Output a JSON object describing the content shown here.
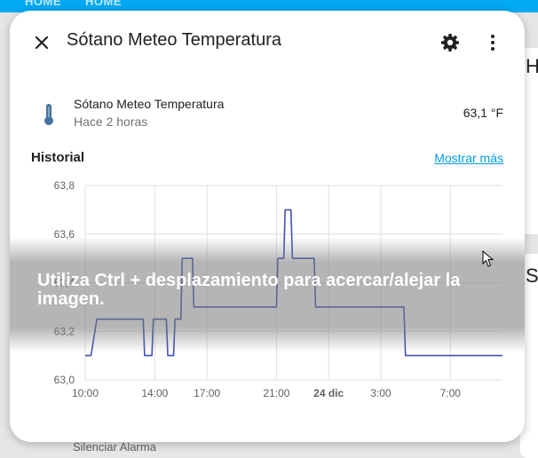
{
  "background": {
    "tabs": [
      "HOME",
      "HOME"
    ],
    "right_letters": [
      "H",
      "S"
    ],
    "bottom_text": "Silenciar Alarma"
  },
  "dialog": {
    "title": "Sótano Meteo Temperatura",
    "icons": {
      "close": "close-icon",
      "settings": "gear-icon",
      "menu": "dots-vertical-icon"
    }
  },
  "entity": {
    "icon": "thermometer-icon",
    "name": "Sótano Meteo Temperatura",
    "last_changed": "Hace 2 horas",
    "state": "63,1 °F"
  },
  "history": {
    "label": "Historial",
    "show_more": "Mostrar más"
  },
  "chart_data": {
    "type": "line",
    "series": [
      {
        "color": "#3f51b5",
        "points": [
          [
            "10:00",
            63.1
          ],
          [
            "10:20",
            63.1
          ],
          [
            "10:40",
            63.25
          ],
          [
            "13:20",
            63.25
          ],
          [
            "13:25",
            63.1
          ],
          [
            "13:50",
            63.1
          ],
          [
            "13:55",
            63.25
          ],
          [
            "14:40",
            63.25
          ],
          [
            "14:45",
            63.1
          ],
          [
            "15:05",
            63.1
          ],
          [
            "15:10",
            63.25
          ],
          [
            "15:30",
            63.25
          ],
          [
            "15:35",
            63.5
          ],
          [
            "16:10",
            63.5
          ],
          [
            "16:15",
            63.3
          ],
          [
            "21:00",
            63.3
          ],
          [
            "21:05",
            63.5
          ],
          [
            "21:25",
            63.5
          ],
          [
            "21:30",
            63.7
          ],
          [
            "21:50",
            63.7
          ],
          [
            "21:55",
            63.5
          ],
          [
            "23:10",
            63.5
          ],
          [
            "23:15",
            63.3
          ],
          [
            "04:20",
            63.3
          ],
          [
            "04:25",
            63.1
          ],
          [
            "10:00",
            63.1
          ]
        ]
      }
    ],
    "x_ticks": [
      "10:00",
      "14:00",
      "17:00",
      "21:00",
      "24 dic",
      "3:00",
      "7:00"
    ],
    "y_ticks": [
      "63,0",
      "63,2",
      "63,4",
      "63,6",
      "63,8"
    ],
    "ylim": [
      63.0,
      63.8
    ],
    "grid": true
  },
  "overlay": {
    "message": "Utiliza Ctrl + desplazamiento para acercar/alejar la imagen."
  }
}
